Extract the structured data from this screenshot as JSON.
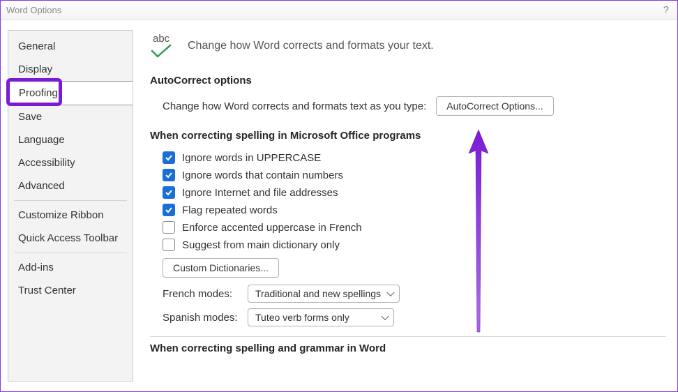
{
  "window": {
    "title": "Word Options"
  },
  "sidebar": {
    "items": [
      "General",
      "Display",
      "Proofing",
      "Save",
      "Language",
      "Accessibility",
      "Advanced",
      "Customize Ribbon",
      "Quick Access Toolbar",
      "Add-ins",
      "Trust Center"
    ],
    "selected_index": 2
  },
  "header": {
    "icon_text": "abc",
    "text": "Change how Word corrects and formats your text."
  },
  "sections": {
    "autocorrect": {
      "title": "AutoCorrect options",
      "label": "Change how Word corrects and formats text as you type:",
      "button": "AutoCorrect Options..."
    },
    "spelling_office": {
      "title": "When correcting spelling in Microsoft Office programs",
      "checks": [
        {
          "label": "Ignore words in UPPERCASE",
          "checked": true
        },
        {
          "label": "Ignore words that contain numbers",
          "checked": true
        },
        {
          "label": "Ignore Internet and file addresses",
          "checked": true
        },
        {
          "label": "Flag repeated words",
          "checked": true
        },
        {
          "label": "Enforce accented uppercase in French",
          "checked": false
        },
        {
          "label": "Suggest from main dictionary only",
          "checked": false
        }
      ],
      "custom_dict_button": "Custom Dictionaries...",
      "french_label": "French modes:",
      "french_value": "Traditional and new spellings",
      "spanish_label": "Spanish modes:",
      "spanish_value": "Tuteo verb forms only"
    },
    "spelling_word": {
      "title": "When correcting spelling and grammar in Word"
    }
  },
  "annotation": {
    "highlight_sidebar_item": "Proofing",
    "arrow_color": "#7c1bd6"
  }
}
